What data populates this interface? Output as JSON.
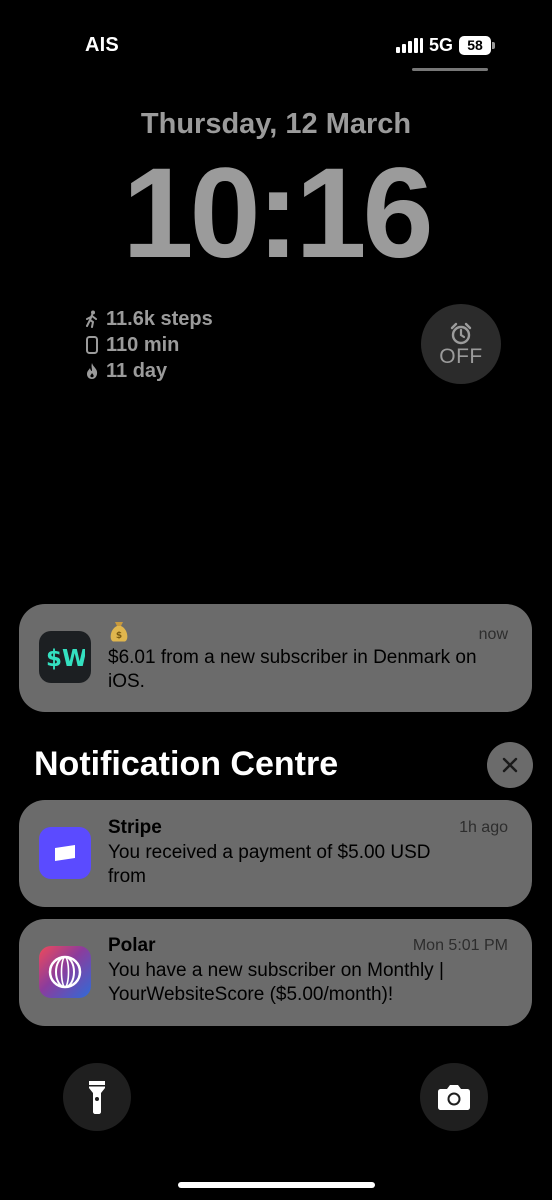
{
  "status_bar": {
    "carrier": "AIS",
    "network": "5G",
    "battery": "58"
  },
  "lock_screen": {
    "date": "Thursday, 12 March",
    "time": "10:16",
    "widgets": [
      {
        "icon": "walking-icon",
        "text": "11.6k steps"
      },
      {
        "icon": "phone-icon",
        "text": "110 min"
      },
      {
        "icon": "flame-icon",
        "text": "11 day"
      }
    ],
    "alarm": {
      "icon": "alarm-clock-icon",
      "label": "OFF"
    }
  },
  "notifications": {
    "current": {
      "app_icon_text": "$W",
      "emoji": "money-bag-icon",
      "timestamp": "now",
      "body": "$6.01 from a new subscriber in Denmark on iOS."
    },
    "centre_title": "Notification Centre",
    "items": [
      {
        "app": "Stripe",
        "timestamp": "1h ago",
        "body_line1": "You received a payment of $5.00 USD",
        "body_line2": "from"
      },
      {
        "app": "Polar",
        "timestamp": "Mon 5:01 PM",
        "body": "You have a new subscriber on Monthly | YourWebsiteScore ($5.00/month)!"
      }
    ]
  },
  "bottom_controls": {
    "left": "flashlight-icon",
    "right": "camera-icon"
  },
  "colors": {
    "background": "#000000",
    "notification_bg": "#6b6b6b",
    "clock_gray": "#9b9b9b",
    "stripe_purple": "#5b4bff"
  }
}
